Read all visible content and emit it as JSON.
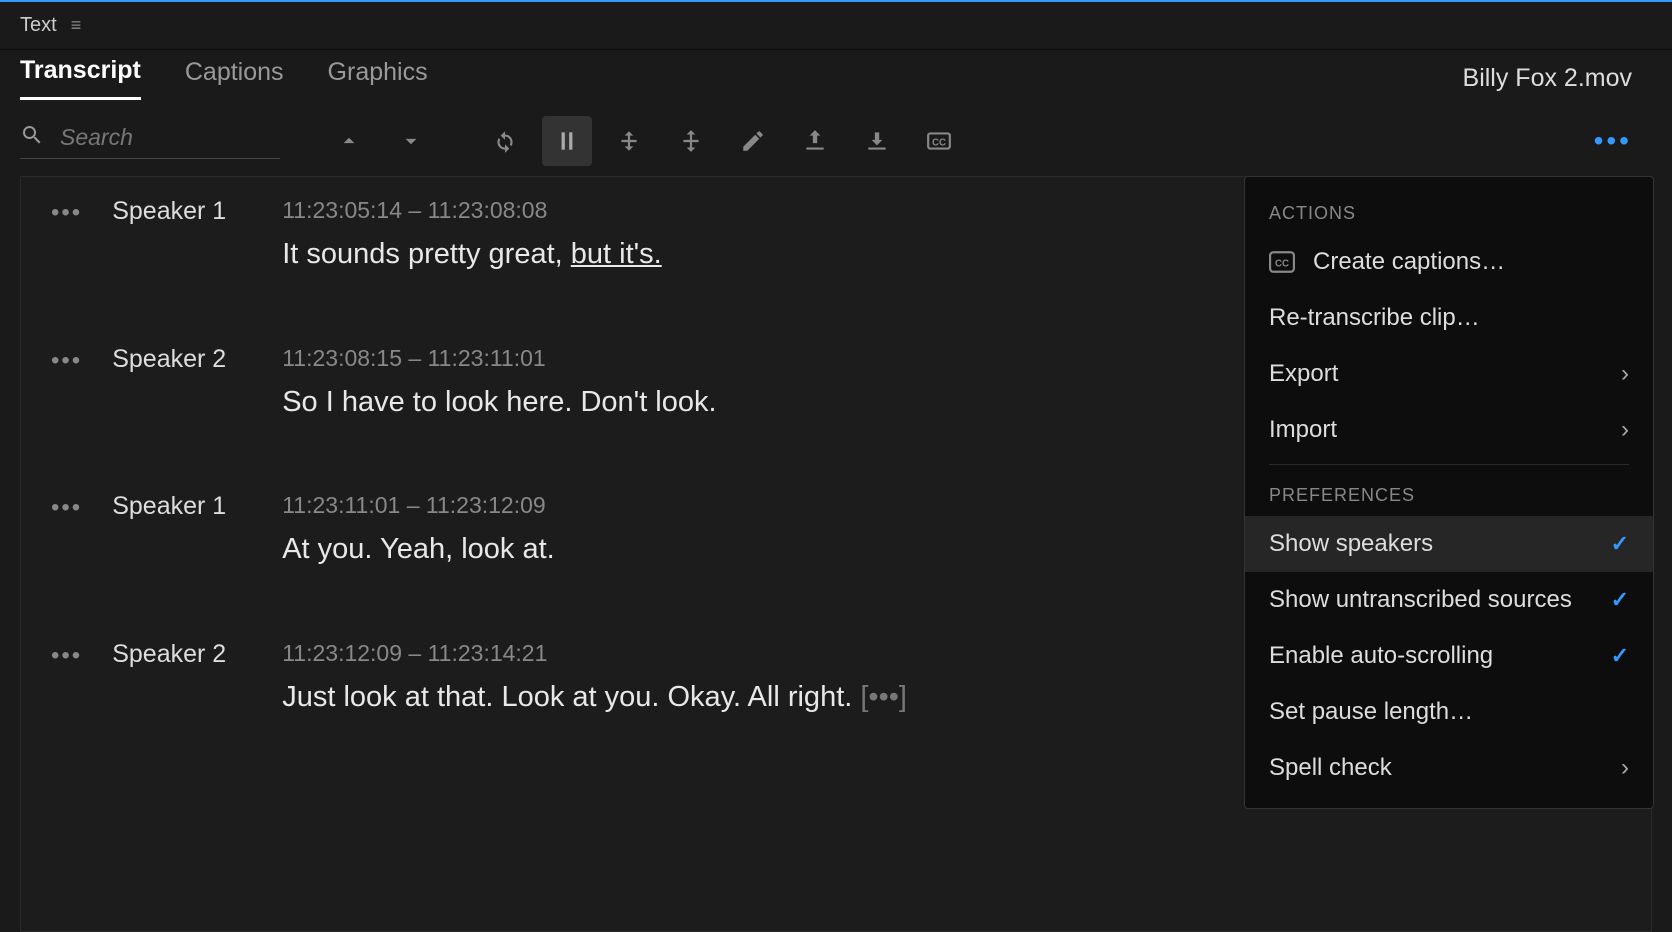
{
  "panel": {
    "title": "Text"
  },
  "tabs": {
    "items": [
      {
        "label": "Transcript",
        "active": true
      },
      {
        "label": "Captions",
        "active": false
      },
      {
        "label": "Graphics",
        "active": false
      }
    ],
    "fileName": "Billy Fox 2.mov"
  },
  "search": {
    "placeholder": "Search"
  },
  "transcript": {
    "segments": [
      {
        "speaker": "Speaker 1",
        "timeStart": "11:23:05:14",
        "timeEnd": "11:23:08:08",
        "text": "It sounds pretty great, ",
        "underlined": "but it's."
      },
      {
        "speaker": "Speaker 2",
        "timeStart": "11:23:08:15",
        "timeEnd": "11:23:11:01",
        "text": "So I have to look here. Don't look."
      },
      {
        "speaker": "Speaker 1",
        "timeStart": "11:23:11:01",
        "timeEnd": "11:23:12:09",
        "text": "At you. Yeah, look at."
      },
      {
        "speaker": "Speaker 2",
        "timeStart": "11:23:12:09",
        "timeEnd": "11:23:14:21",
        "text": "Just look at that. Look at you. Okay. All right.",
        "trailing": true
      }
    ]
  },
  "menu": {
    "actionsLabel": "ACTIONS",
    "preferencesLabel": "PREFERENCES",
    "actions": [
      {
        "label": "Create captions…",
        "icon": "cc"
      },
      {
        "label": "Re-transcribe clip…"
      },
      {
        "label": "Export",
        "chevron": true
      },
      {
        "label": "Import",
        "chevron": true
      }
    ],
    "preferences": [
      {
        "label": "Show speakers",
        "checked": true,
        "highlighted": true
      },
      {
        "label": "Show untranscribed sources",
        "checked": true
      },
      {
        "label": "Enable auto-scrolling",
        "checked": true
      },
      {
        "label": "Set pause length…"
      },
      {
        "label": "Spell check",
        "chevron": true
      }
    ]
  }
}
